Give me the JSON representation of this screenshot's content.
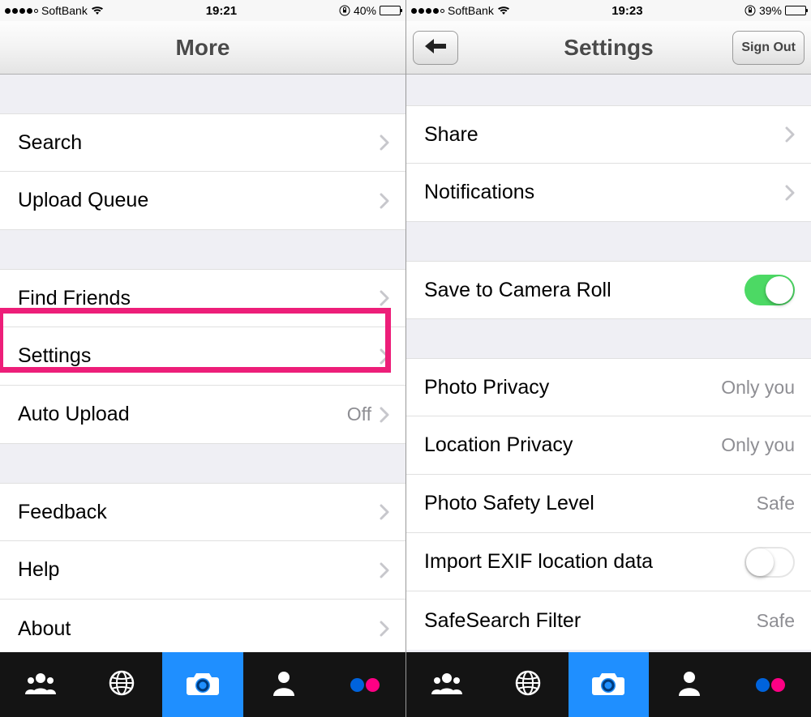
{
  "left": {
    "status": {
      "carrier": "SoftBank",
      "time": "19:21",
      "battery_pct": "40%",
      "battery_fill": 40
    },
    "nav": {
      "title": "More"
    },
    "groups": [
      {
        "rows": [
          {
            "label": "Search",
            "chevron": true
          },
          {
            "label": "Upload Queue",
            "chevron": true
          }
        ]
      },
      {
        "rows": [
          {
            "label": "Find Friends",
            "chevron": true
          },
          {
            "label": "Settings",
            "chevron": true,
            "highlighted": true
          },
          {
            "label": "Auto Upload",
            "value": "Off",
            "chevron": true
          }
        ]
      },
      {
        "rows": [
          {
            "label": "Feedback",
            "chevron": true
          },
          {
            "label": "Help",
            "chevron": true
          },
          {
            "label": "About",
            "chevron": true
          }
        ]
      }
    ]
  },
  "right": {
    "status": {
      "carrier": "SoftBank",
      "time": "19:23",
      "battery_pct": "39%",
      "battery_fill": 39
    },
    "nav": {
      "title": "Settings",
      "back": true,
      "sign_out_label": "Sign Out"
    },
    "groups": [
      {
        "gap": "small",
        "rows": [
          {
            "label": "Share",
            "chevron": true
          },
          {
            "label": "Notifications",
            "chevron": true
          }
        ]
      },
      {
        "rows": [
          {
            "label": "Save to Camera Roll",
            "toggle": "on"
          }
        ]
      },
      {
        "rows": [
          {
            "label": "Photo Privacy",
            "value": "Only you"
          },
          {
            "label": "Location Privacy",
            "value": "Only you"
          },
          {
            "label": "Photo Safety Level",
            "value": "Safe"
          },
          {
            "label": "Import EXIF location data",
            "toggle": "off"
          },
          {
            "label": "SafeSearch Filter",
            "value": "Safe"
          }
        ]
      }
    ]
  },
  "highlight_color": "#ed1e79"
}
